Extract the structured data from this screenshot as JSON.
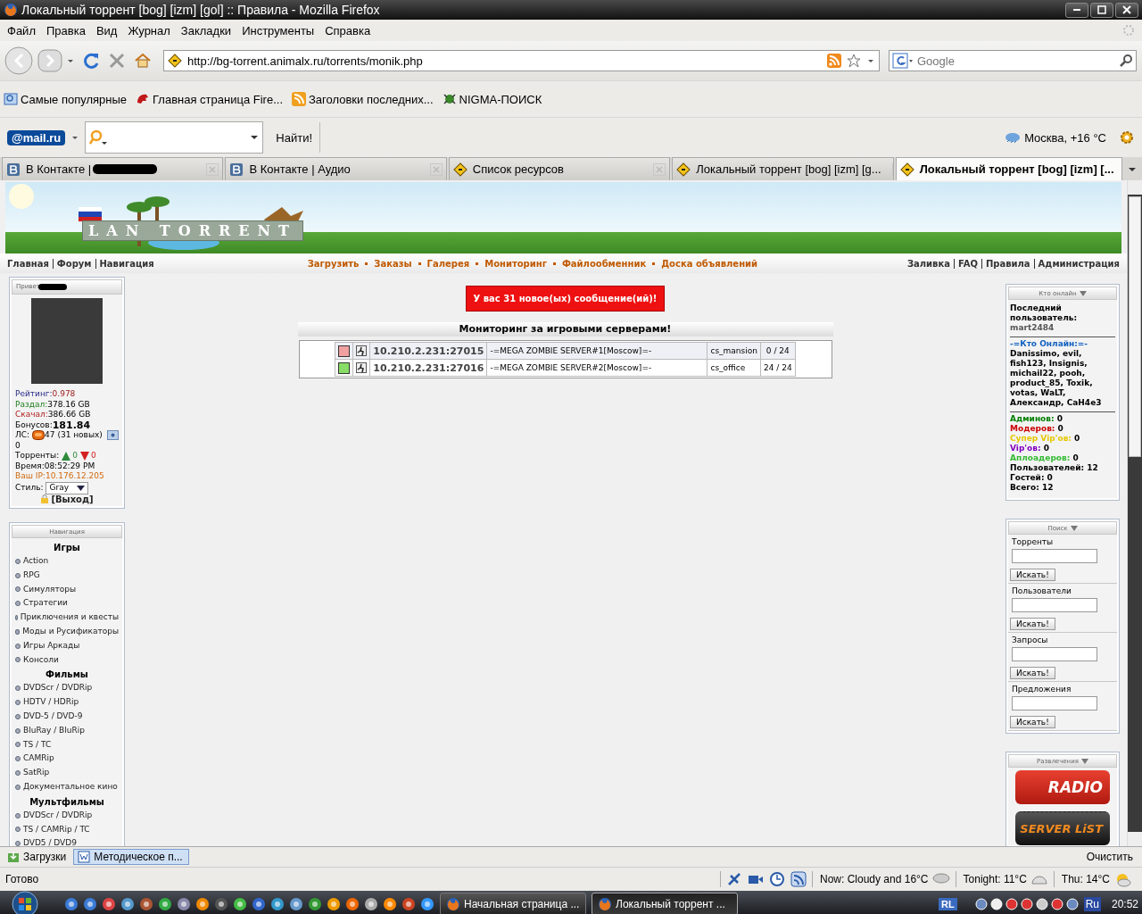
{
  "window": {
    "title": "Локальный торрент [bog] [izm] [gol] :: Правила - Mozilla Firefox"
  },
  "menu": [
    "Файл",
    "Правка",
    "Вид",
    "Журнал",
    "Закладки",
    "Инструменты",
    "Справка"
  ],
  "navbar": {
    "url": "http://bg-torrent.animalx.ru/torrents/monik.php",
    "search_placeholder": "Google"
  },
  "bookmarks": [
    "Самые популярные",
    "Главная страница Fire...",
    "Заголовки последних...",
    "NIGMA-ПОИСК"
  ],
  "mailru": {
    "logo": "@mail.ru",
    "button": "Найти!",
    "weather": "Москва, +16 °C"
  },
  "tabs": [
    {
      "label": "В Контакте |",
      "kind": "vk",
      "redacted": true,
      "selected": false
    },
    {
      "label": "В Контакте | Аудио",
      "kind": "vk",
      "redacted": false,
      "selected": false
    },
    {
      "label": "Список ресурсов",
      "kind": "sign",
      "redacted": false,
      "selected": false
    },
    {
      "label": "Локальный торрент [bog] [izm] [g...",
      "kind": "sign",
      "redacted": false,
      "selected": false
    },
    {
      "label": "Локальный торрент [bog] [izm] [...",
      "kind": "sign",
      "redacted": false,
      "selected": true
    }
  ],
  "site": {
    "logo": "LAN TORRENT",
    "nav_left": [
      "Главная",
      "Форум",
      "Навигация"
    ],
    "nav_center": [
      "Загрузить",
      "Заказы",
      "Галерея",
      "Мониторинг",
      "Файлообменник",
      "Доска объявлений"
    ],
    "nav_right": [
      "Заливка",
      "FAQ",
      "Правила",
      "Администрация"
    ],
    "user_panel": {
      "greeting": "Привет",
      "rating": {
        "label": "Рейтинг:",
        "value": "0.978"
      },
      "uploaded": {
        "label": "Раздал:",
        "value": "378.16 GB"
      },
      "downloaded": {
        "label": "Скачал:",
        "value": "386.66 GB"
      },
      "bonus": {
        "label": "Бонусов:",
        "value": "181.84"
      },
      "messages": {
        "label": "ЛС:",
        "count": "47 (31 новых)",
        "extra": "0"
      },
      "torrents": {
        "label": "Торренты:",
        "seeding": "0",
        "leeching": "0"
      },
      "time": {
        "label": "Время:",
        "value": "08:52:29 PM"
      },
      "ip": {
        "label": "Ваш IP:",
        "value": "10.176.12.205"
      },
      "style": {
        "label": "Стиль:",
        "value": "Gray"
      },
      "logout": "[Выход]"
    },
    "navigation": {
      "title": "Навигация",
      "sections": [
        {
          "heading": "Игры",
          "items": [
            "Action",
            "RPG",
            "Симуляторы",
            "Стратегии",
            "Приключения и квесты",
            "Моды и Русификаторы",
            "Игры Аркады",
            "Консоли"
          ]
        },
        {
          "heading": "Фильмы",
          "items": [
            "DVDScr / DVDRip",
            "HDTV / HDRip",
            "DVD-5 / DVD-9",
            "BluRay / BluRip",
            "TS / TC",
            "CAMRip",
            "SatRip",
            "Документальное кино"
          ]
        },
        {
          "heading": "Мультфильмы",
          "items": [
            "DVDScr / DVDRip",
            "TS / CAMRip / TC",
            "DVD5 / DVD9"
          ]
        }
      ]
    },
    "alert": "У вас 31 новое(ых) сообщение(ий)!",
    "monitor": {
      "title": "Мониторинг за игровыми серверами!",
      "servers": [
        {
          "online": false,
          "address": "10.210.2.231:27015",
          "name": "-=MEGA ZOMBIE SERVER#1[Moscow]=-",
          "map": "cs_mansion",
          "players": "0 / 24"
        },
        {
          "online": true,
          "address": "10.210.2.231:27016",
          "name": "-=MEGA ZOMBIE SERVER#2[Moscow]=-",
          "map": "cs_office",
          "players": "24 / 24"
        }
      ]
    },
    "online": {
      "title": "Кто онлайн",
      "last_label": "Последний пользователь:",
      "last_user": "mart2484",
      "heading": "-=Кто Онлайн:=-",
      "users": "Danissimo, evil, fish123, Insignis, michail22, pooh, product_85, Toxik, votas, WaLT, Александр, CaH4e3",
      "counts": [
        {
          "label": "Админов:",
          "value": "0",
          "color": "#008000"
        },
        {
          "label": "Модеров:",
          "value": "0",
          "color": "#cc0000"
        },
        {
          "label": "Супер Vip'ов:",
          "value": "0",
          "color": "#e6c800"
        },
        {
          "label": "Vip'ов:",
          "value": "0",
          "color": "#8000c0"
        },
        {
          "label": "Аплоадеров:",
          "value": "0",
          "color": "#33bb33"
        },
        {
          "label": "Пользователей:",
          "value": "12",
          "color": "#000000"
        },
        {
          "label": "Гостей:",
          "value": "0",
          "color": "#000000"
        },
        {
          "label": "Всего:",
          "value": "12",
          "color": "#000000"
        }
      ]
    },
    "search": {
      "title": "Поиск",
      "groups": [
        {
          "label": "Торренты",
          "button": "Искать!"
        },
        {
          "label": "Пользователи",
          "button": "Искать!"
        },
        {
          "label": "Запросы",
          "button": "Искать!"
        },
        {
          "label": "Предложения",
          "button": "Искать!"
        }
      ]
    },
    "fun": {
      "title": "Развлечения",
      "banners": [
        {
          "kind": "radio",
          "text": "RADIO"
        },
        {
          "kind": "server",
          "text": "SERVER LiST"
        }
      ]
    }
  },
  "downloads": {
    "items": [
      {
        "label": "Загрузки",
        "selected": false
      },
      {
        "label": "Методическое п...",
        "selected": true
      }
    ],
    "clear": "Очистить"
  },
  "status": {
    "text": "Готово",
    "weather": [
      "Now: Cloudy and 16°C",
      "Tonight: 11°C",
      "Thu: 14°C"
    ]
  },
  "taskbar": {
    "tasks": [
      {
        "label": "Начальная страница ...",
        "selected": false
      },
      {
        "label": "Локальный торрент ...",
        "selected": true
      }
    ],
    "lang_icon": "RL",
    "lang": "Ru",
    "clock": "20:52"
  }
}
